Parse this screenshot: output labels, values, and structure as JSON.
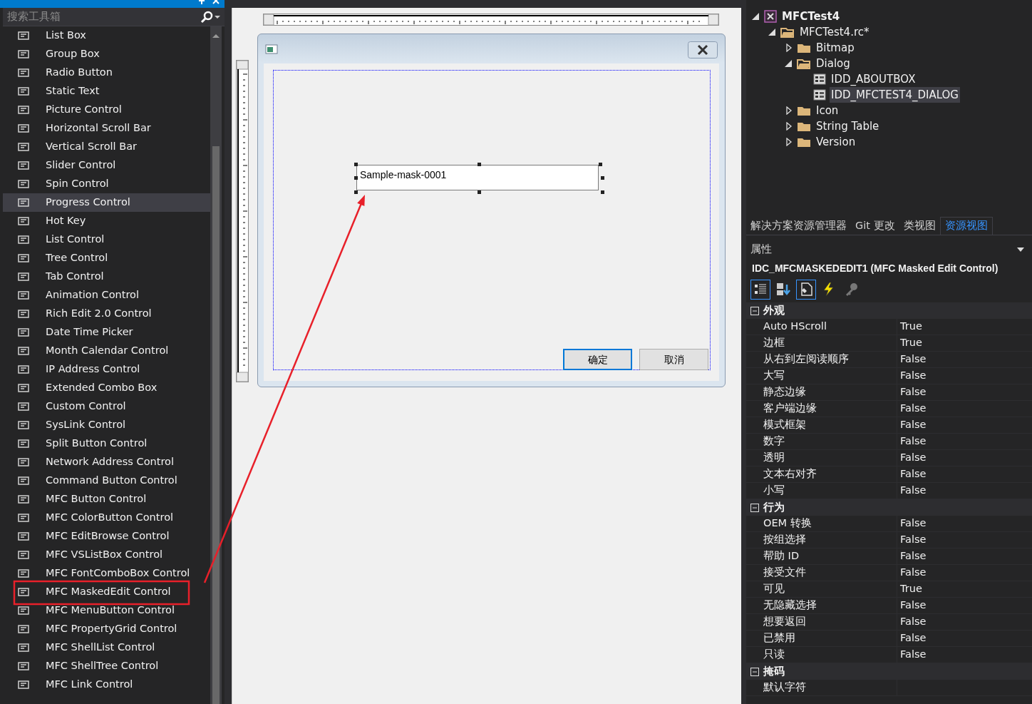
{
  "toolbox": {
    "search": {
      "placeholder": "搜索工具箱"
    },
    "items": [
      {
        "label": "List Box",
        "selected": false,
        "boxed": false
      },
      {
        "label": "Group Box",
        "selected": false,
        "boxed": false
      },
      {
        "label": "Radio Button",
        "selected": false,
        "boxed": false
      },
      {
        "label": "Static Text",
        "selected": false,
        "boxed": false
      },
      {
        "label": "Picture Control",
        "selected": false,
        "boxed": false
      },
      {
        "label": "Horizontal Scroll Bar",
        "selected": false,
        "boxed": false
      },
      {
        "label": "Vertical Scroll Bar",
        "selected": false,
        "boxed": false
      },
      {
        "label": "Slider Control",
        "selected": false,
        "boxed": false
      },
      {
        "label": "Spin Control",
        "selected": false,
        "boxed": false
      },
      {
        "label": "Progress Control",
        "selected": true,
        "boxed": false
      },
      {
        "label": "Hot Key",
        "selected": false,
        "boxed": false
      },
      {
        "label": "List Control",
        "selected": false,
        "boxed": false
      },
      {
        "label": "Tree Control",
        "selected": false,
        "boxed": false
      },
      {
        "label": "Tab Control",
        "selected": false,
        "boxed": false
      },
      {
        "label": "Animation Control",
        "selected": false,
        "boxed": false
      },
      {
        "label": "Rich Edit 2.0 Control",
        "selected": false,
        "boxed": false
      },
      {
        "label": "Date Time Picker",
        "selected": false,
        "boxed": false
      },
      {
        "label": "Month Calendar Control",
        "selected": false,
        "boxed": false
      },
      {
        "label": "IP Address Control",
        "selected": false,
        "boxed": false
      },
      {
        "label": "Extended Combo Box",
        "selected": false,
        "boxed": false
      },
      {
        "label": "Custom Control",
        "selected": false,
        "boxed": false
      },
      {
        "label": "SysLink Control",
        "selected": false,
        "boxed": false
      },
      {
        "label": "Split Button Control",
        "selected": false,
        "boxed": false
      },
      {
        "label": "Network Address Control",
        "selected": false,
        "boxed": false
      },
      {
        "label": "Command Button Control",
        "selected": false,
        "boxed": false
      },
      {
        "label": "MFC Button Control",
        "selected": false,
        "boxed": false
      },
      {
        "label": "MFC ColorButton Control",
        "selected": false,
        "boxed": false
      },
      {
        "label": "MFC EditBrowse Control",
        "selected": false,
        "boxed": false
      },
      {
        "label": "MFC VSListBox Control",
        "selected": false,
        "boxed": false
      },
      {
        "label": "MFC FontComboBox Control",
        "selected": false,
        "boxed": false
      },
      {
        "label": "MFC MaskedEdit Control",
        "selected": false,
        "boxed": true
      },
      {
        "label": "MFC MenuButton Control",
        "selected": false,
        "boxed": false
      },
      {
        "label": "MFC PropertyGrid Control",
        "selected": false,
        "boxed": false
      },
      {
        "label": "MFC ShellList Control",
        "selected": false,
        "boxed": false
      },
      {
        "label": "MFC ShellTree Control",
        "selected": false,
        "boxed": false
      },
      {
        "label": "MFC Link Control",
        "selected": false,
        "boxed": false
      }
    ]
  },
  "dialog": {
    "edit_value": "Sample-mask-0001",
    "buttons": [
      {
        "label": "确定",
        "default": true
      },
      {
        "label": "取消",
        "default": false
      }
    ]
  },
  "resource_view": {
    "tree": [
      {
        "label": "MFCTest4",
        "kind": "project",
        "expanded": true,
        "selected": false,
        "children": [
          {
            "label": "MFCTest4.rc*",
            "kind": "rc",
            "expanded": true,
            "selected": false,
            "children": [
              {
                "label": "Bitmap",
                "kind": "folder",
                "expanded": false,
                "selected": false
              },
              {
                "label": "Dialog",
                "kind": "folder",
                "expanded": true,
                "selected": false,
                "children": [
                  {
                    "label": "IDD_ABOUTBOX",
                    "kind": "dialog",
                    "selected": false
                  },
                  {
                    "label": "IDD_MFCTEST4_DIALOG",
                    "kind": "dialog",
                    "selected": true
                  }
                ]
              },
              {
                "label": "Icon",
                "kind": "folder",
                "expanded": false,
                "selected": false
              },
              {
                "label": "String Table",
                "kind": "folder",
                "expanded": false,
                "selected": false
              },
              {
                "label": "Version",
                "kind": "folder",
                "expanded": false,
                "selected": false
              }
            ]
          }
        ]
      }
    ]
  },
  "panel_tabs": [
    {
      "label": "解决方案资源管理器",
      "selected": false
    },
    {
      "label": "Git 更改",
      "selected": false
    },
    {
      "label": "类视图",
      "selected": false
    },
    {
      "label": "资源视图",
      "selected": true
    }
  ],
  "properties": {
    "title": "属性",
    "object": "IDC_MFCMASKEDEDIT1 (MFC Masked Edit Control)",
    "toolbar": [
      {
        "kind": "categorized",
        "selected": true
      },
      {
        "kind": "alphabetical",
        "selected": false
      },
      {
        "kind": "properties",
        "selected": true
      },
      {
        "kind": "events",
        "selected": false
      },
      {
        "kind": "pages",
        "selected": false
      }
    ],
    "categories": [
      {
        "label": "外观",
        "expanded": true,
        "rows": [
          {
            "name": "Auto HScroll",
            "value": "True"
          },
          {
            "name": "边框",
            "value": "True"
          },
          {
            "name": "从右到左阅读顺序",
            "value": "False"
          },
          {
            "name": "大写",
            "value": "False"
          },
          {
            "name": "静态边缘",
            "value": "False"
          },
          {
            "name": "客户端边缘",
            "value": "False"
          },
          {
            "name": "模式框架",
            "value": "False"
          },
          {
            "name": "数字",
            "value": "False"
          },
          {
            "name": "透明",
            "value": "False"
          },
          {
            "name": "文本右对齐",
            "value": "False"
          },
          {
            "name": "小写",
            "value": "False"
          }
        ]
      },
      {
        "label": "行为",
        "expanded": true,
        "rows": [
          {
            "name": "OEM 转换",
            "value": "False"
          },
          {
            "name": "按组选择",
            "value": "False"
          },
          {
            "name": "帮助 ID",
            "value": "False"
          },
          {
            "name": "接受文件",
            "value": "False"
          },
          {
            "name": "可见",
            "value": "True"
          },
          {
            "name": "无隐藏选择",
            "value": "False"
          },
          {
            "name": "想要返回",
            "value": "False"
          },
          {
            "name": "已禁用",
            "value": "False"
          },
          {
            "name": "只读",
            "value": "False"
          }
        ]
      },
      {
        "label": "掩码",
        "expanded": true,
        "rows": [
          {
            "name": "默认字符"
          }
        ]
      }
    ]
  }
}
